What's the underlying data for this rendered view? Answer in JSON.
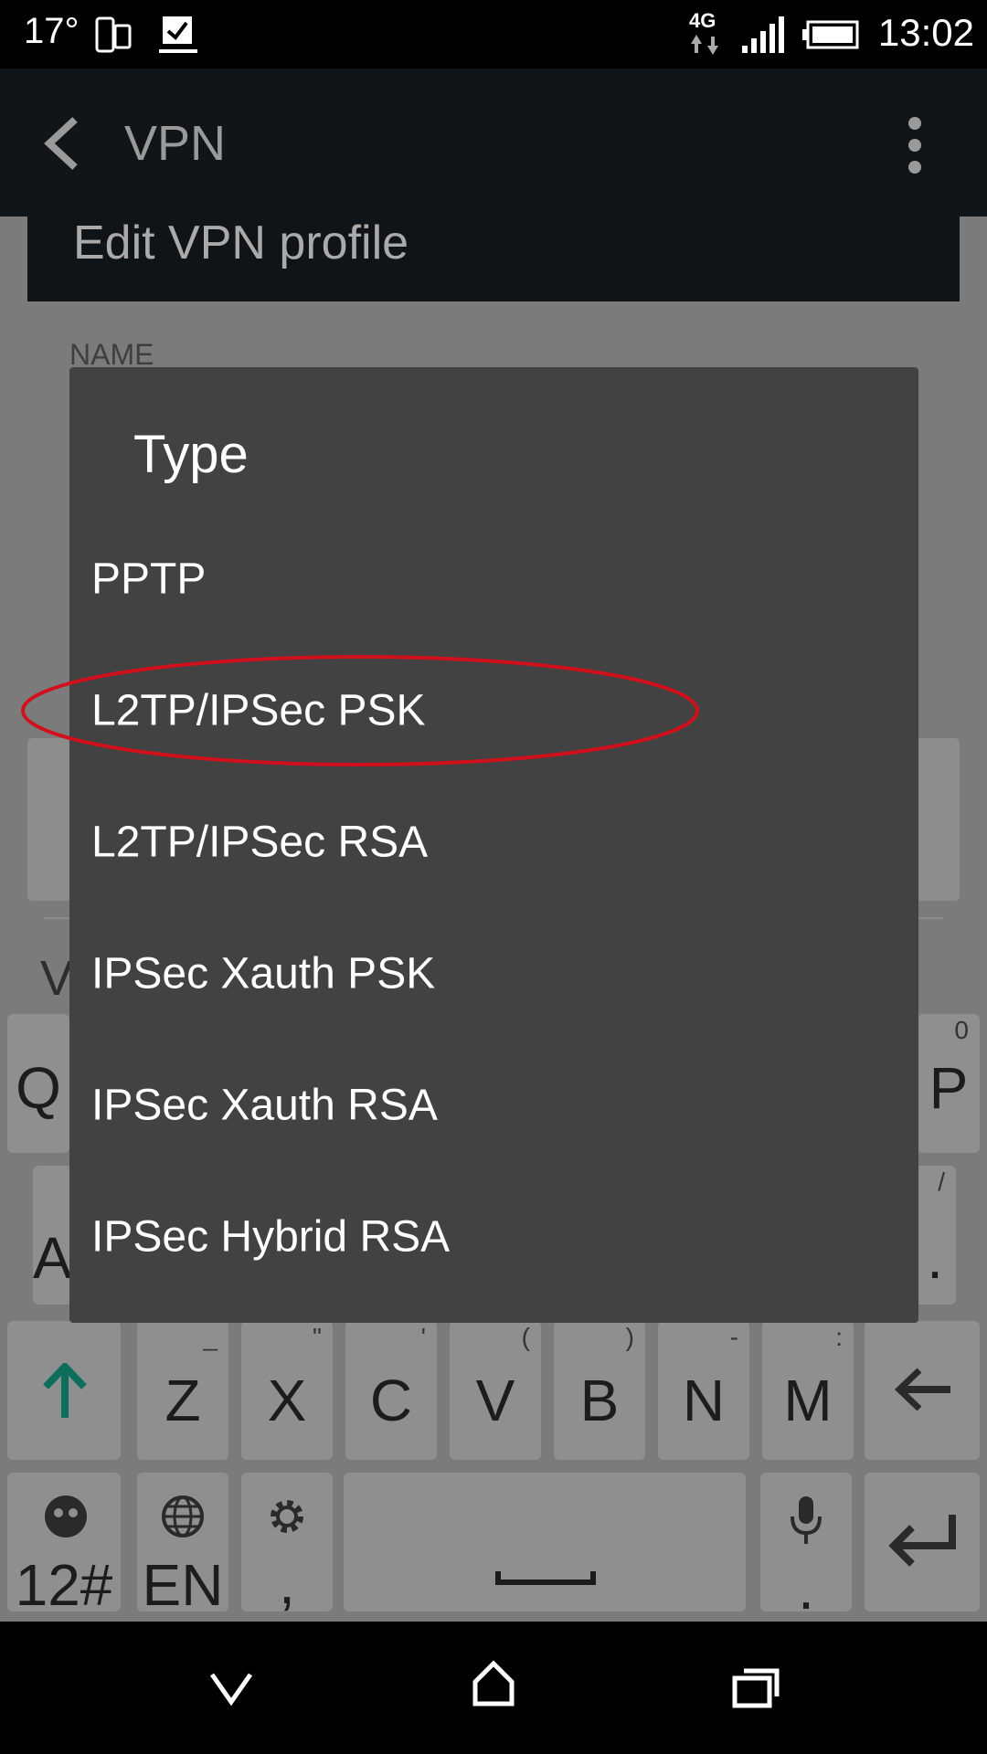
{
  "status_bar": {
    "temperature": "17°",
    "network": "4G",
    "time": "13:02"
  },
  "action_bar": {
    "title": "VPN",
    "back_icon": "chevron-left-icon",
    "overflow_icon": "more-vert-icon"
  },
  "screen": {
    "header": "Edit VPN profile",
    "name_label": "NAME",
    "partial_text": "V"
  },
  "dialog": {
    "title": "Type",
    "options": [
      {
        "label": "PPTP"
      },
      {
        "label": "L2TP/IPSec PSK",
        "highlighted": true
      },
      {
        "label": "L2TP/IPSec RSA"
      },
      {
        "label": "IPSec Xauth PSK"
      },
      {
        "label": "IPSec Xauth RSA"
      },
      {
        "label": "IPSec Hybrid RSA"
      }
    ]
  },
  "keyboard": {
    "row1_left": "Q",
    "row1_right": "P",
    "row1_right_alt": "0",
    "row2_left": "A",
    "row2_right": ".",
    "row2_right_alt": "/",
    "row3": [
      {
        "key": "Z",
        "alt": "_"
      },
      {
        "key": "X",
        "alt": "\""
      },
      {
        "key": "C",
        "alt": "'"
      },
      {
        "key": "V",
        "alt": "("
      },
      {
        "key": "B",
        "alt": ")"
      },
      {
        "key": "N",
        "alt": "-"
      },
      {
        "key": "M",
        "alt": ":"
      }
    ],
    "numbers_label": "12#",
    "language_label": "EN",
    "settings_sub": ",",
    "mic_sub": "."
  },
  "colors": {
    "highlight": "#d0101c",
    "shift_arrow": "#0e6e5c",
    "dialog_bg": "#424242"
  }
}
